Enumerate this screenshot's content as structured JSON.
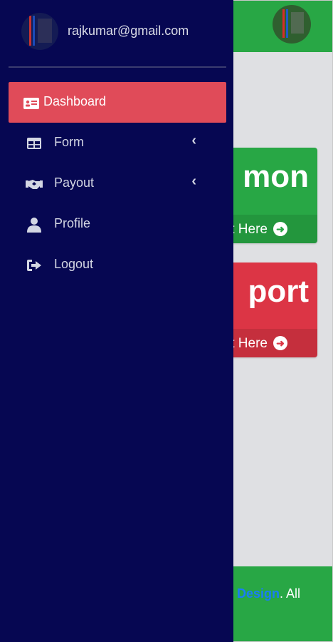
{
  "user": {
    "email": "rajkumar@gmail.com"
  },
  "nav": {
    "items": [
      {
        "label": "Dashboard",
        "active": true,
        "icon": "id-card-icon"
      },
      {
        "label": "Form",
        "active": false,
        "icon": "table-icon",
        "caret": "‹"
      },
      {
        "label": "Payout",
        "active": false,
        "icon": "handshake-icon",
        "caret": "‹"
      },
      {
        "label": "Profile",
        "active": false,
        "icon": "user-icon"
      },
      {
        "label": "Logout",
        "active": false,
        "icon": "sign-out-icon"
      }
    ]
  },
  "cards": [
    {
      "big_text": "e mon",
      "link": "t Here",
      "color": "#28a745"
    },
    {
      "big_text": "port",
      "link": "t Here",
      "color": "#dc3545"
    }
  ],
  "footer": {
    "link": "Design",
    "suffix": ". All"
  },
  "colors": {
    "sidebar": "#060752",
    "active": "#e04b59",
    "green": "#28a745",
    "red": "#dc3545"
  }
}
